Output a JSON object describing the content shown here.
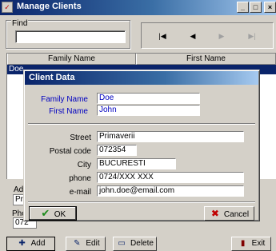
{
  "window": {
    "title": "Manage Clients",
    "caption_buttons": {
      "minimize": "_",
      "maximize": "□",
      "close": "×"
    }
  },
  "find": {
    "label": "Find",
    "value": ""
  },
  "navigation": {
    "first": "|◀",
    "prev": "◀",
    "next": "▶",
    "last": "▶|"
  },
  "grid": {
    "columns": [
      "Family Name",
      "First Name"
    ],
    "rows": [
      {
        "family_name": "Doe",
        "first_name": ""
      }
    ]
  },
  "background_fields": {
    "address_label": "Adre",
    "address_value": "Prir",
    "phone_label": "Pho",
    "phone_value": "072"
  },
  "buttons": {
    "add": "Add",
    "edit": "Edit",
    "delete": "Delete",
    "exit": "Exit"
  },
  "dialog": {
    "title": "Client Data",
    "fields": {
      "family_name": {
        "label": "Family Name",
        "value": "Doe"
      },
      "first_name": {
        "label": "First Name",
        "value": "John"
      },
      "street": {
        "label": "Street",
        "value": "Primaverii"
      },
      "postal_code": {
        "label": "Postal code",
        "value": "072354"
      },
      "city": {
        "label": "City",
        "value": "BUCURESTI"
      },
      "phone": {
        "label": "phone",
        "value": "0724/XXX XXX"
      },
      "email": {
        "label": "e-mail",
        "value": "john.doe@email.com"
      }
    },
    "ok_label": "OK",
    "cancel_label": "Cancel"
  },
  "icons": {
    "ok": "check-icon",
    "cancel": "x-icon",
    "add": "add-record-icon",
    "edit": "edit-record-icon",
    "delete": "delete-record-icon",
    "exit": "exit-door-icon"
  },
  "colors": {
    "title_bar": "#0a246a",
    "face": "#d4d0c8",
    "selection": "#0a246a",
    "field_text": "#0000c0"
  }
}
